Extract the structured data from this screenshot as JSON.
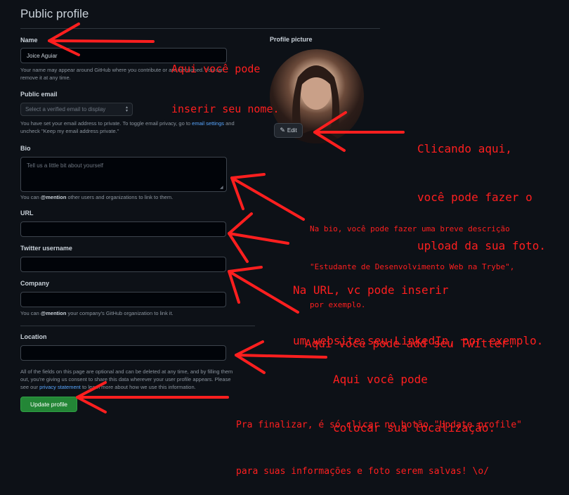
{
  "page": {
    "title": "Public profile"
  },
  "name": {
    "label": "Name",
    "value": "Joice Aguiar",
    "note_line1": "Your name may appear around GitHub where you contribute or are mentioned. You can",
    "note_line2": "remove it at any time."
  },
  "email": {
    "label": "Public email",
    "placeholder": "Select a verified email to display",
    "note_line1_a": "You have set your email address to private. To toggle email privacy, go to ",
    "note_link": "email settings",
    "note_line1_b": " and",
    "note_line2": "uncheck \"Keep my email address private.\""
  },
  "bio": {
    "label": "Bio",
    "placeholder": "Tell us a little bit about yourself",
    "note_a": "You can ",
    "note_mention": "@mention",
    "note_b": " other users and organizations to link to them."
  },
  "url": {
    "label": "URL",
    "value": ""
  },
  "twitter": {
    "label": "Twitter username",
    "value": ""
  },
  "company": {
    "label": "Company",
    "value": "",
    "note_a": "You can ",
    "note_mention": "@mention",
    "note_b": " your company's GitHub organization to link it."
  },
  "location": {
    "label": "Location",
    "value": ""
  },
  "footer_note": {
    "line1": "All of the fields on this page are optional and can be deleted at any time, and by filling them",
    "line2": "out, you're giving us consent to share this data wherever your user profile appears. Please",
    "line3_a": "see our ",
    "line3_link": "privacy statement",
    "line3_b": " to learn more about how we use this information."
  },
  "update_button": "Update profile",
  "picture": {
    "label": "Profile picture",
    "edit_label": "Edit"
  },
  "annotations": {
    "name_1": "Aqui você pode",
    "name_2": "inserir seu nome.",
    "photo_1": "Clicando aqui,",
    "photo_2": "você pode fazer o",
    "photo_3": "upload da sua foto.",
    "bio_1": "Na bio, você pode fazer uma breve descrição",
    "bio_2": "\"Estudante de Desenvolvimento Web na Trybe\",",
    "bio_3": "por exemplo.",
    "url_1": "Na URL, vc pode inserir",
    "url_2": "um website,seu LinkedIn, por exemplo.",
    "twitter_1": "Aqui você pode add seu Twitter.",
    "location_1": "Aqui você pode",
    "location_2": "colocar sua localização.",
    "final_1": "Pra finalizar, é só clicar no botão \"Update profile\"",
    "final_2": "para suas informações e foto serem salvas! \\o/"
  },
  "colors": {
    "background": "#0d1117",
    "annotation": "#ff1f1f",
    "button_green": "#238636",
    "link": "#58a6ff"
  }
}
